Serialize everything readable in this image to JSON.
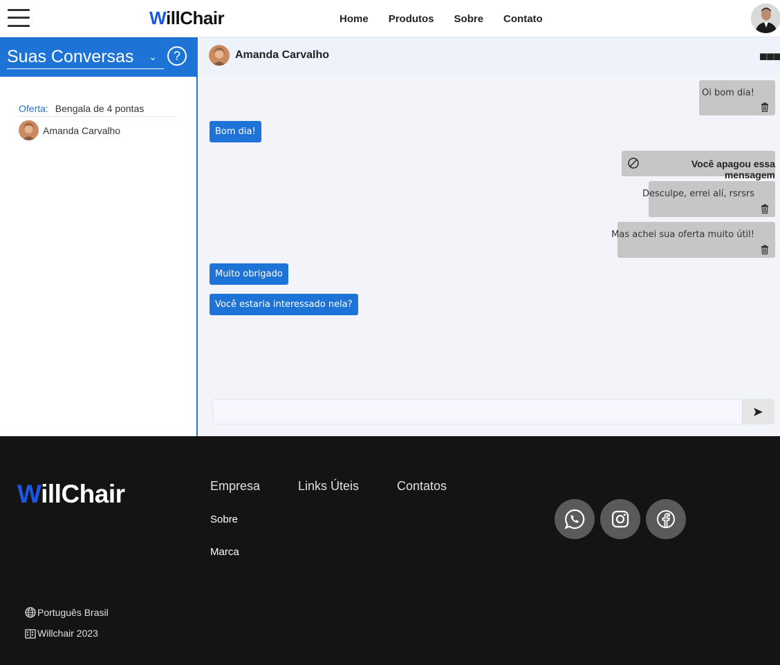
{
  "header": {
    "logo_first": "W",
    "logo_rest": "illChair",
    "nav": [
      "Home",
      "Produtos",
      "Sobre",
      "Contato"
    ]
  },
  "sidebar": {
    "title": "Suas Conversas",
    "help": "?",
    "conversations": [
      {
        "offer_label": "Oferta:",
        "offer_value": "Bengala de 4 pontas",
        "user": "Amanda Carvalho"
      }
    ]
  },
  "chat": {
    "contact_name": "Amanda Carvalho",
    "messages": [
      {
        "direction": "sent",
        "text": "Oi bom dia!",
        "deletable": true
      },
      {
        "direction": "received",
        "text": "Bom dia!"
      },
      {
        "direction": "sent",
        "text": "Você apagou essa mensagem",
        "deleted": true
      },
      {
        "direction": "sent",
        "text": "Desculpe, errei alí, rsrsrs",
        "deletable": true
      },
      {
        "direction": "sent",
        "text": "Mas achei sua oferta muito útil!",
        "deletable": true
      },
      {
        "direction": "received",
        "text": "Muito obrigado"
      },
      {
        "direction": "received",
        "text": "Você estaria interessado nela?"
      }
    ],
    "input_value": "",
    "send_icon": "send-icon"
  },
  "footer": {
    "logo_first": "W",
    "logo_rest": "illChair",
    "columns": [
      "Empresa",
      "Links Úteis",
      "Contatos"
    ],
    "empresa_links": [
      "Sobre",
      "Marca"
    ],
    "social": [
      "whatsapp-icon",
      "instagram-icon",
      "facebook-icon"
    ],
    "language": "Português Brasil",
    "copyright": "Willchair 2023"
  },
  "colors": {
    "primary": "#1e74d6",
    "brand_w": "#1a56e8",
    "sent_bubble": "#c6c6c6",
    "footer_bg": "#141414",
    "chat_bg": "#f2f4f9"
  }
}
